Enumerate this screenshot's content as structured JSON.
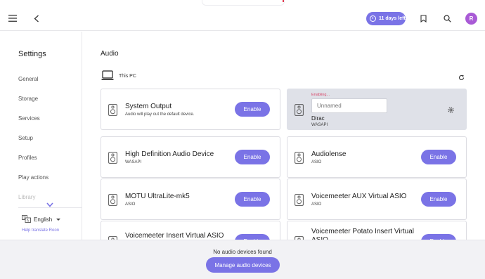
{
  "topbar": {
    "trial_label": "11 days left",
    "avatar_initial": "R",
    "accent_color": "#7a73e6",
    "avatar_color": "#a95ad6"
  },
  "sidebar": {
    "title": "Settings",
    "items": [
      {
        "label": "General"
      },
      {
        "label": "Storage"
      },
      {
        "label": "Services"
      },
      {
        "label": "Setup"
      },
      {
        "label": "Profiles"
      },
      {
        "label": "Play actions"
      },
      {
        "label": "Library"
      }
    ],
    "language": "English",
    "help_translate": "Help translate Roon"
  },
  "main": {
    "title": "Audio",
    "host_label": "This PC",
    "devices": [
      {
        "name": "System Output",
        "sub": "Audio will play out the default device.",
        "button": "Enable"
      },
      {
        "name": "High Definition Audio Device",
        "sub": "WASAPI",
        "button": "Enable"
      },
      {
        "name": "Audiolense",
        "sub": "ASIO",
        "button": "Enable"
      },
      {
        "name": "MOTU UltraLite-mk5",
        "sub": "ASIO",
        "button": "Enable"
      },
      {
        "name": "Voicemeeter AUX Virtual ASIO",
        "sub": "ASIO",
        "button": "Enable"
      },
      {
        "name": "Voicemeeter Insert Virtual ASIO",
        "sub": "",
        "button": "Enable"
      },
      {
        "name": "Voicemeeter Potato Insert Virtual ASIO",
        "sub": "",
        "button": "Enable"
      }
    ],
    "dirac": {
      "status": "Enabling...",
      "placeholder": "Unnamed",
      "name": "Dirac",
      "sub": "WASAPI"
    }
  },
  "bottom": {
    "message": "No audio devices found",
    "button": "Manage audio devices"
  }
}
